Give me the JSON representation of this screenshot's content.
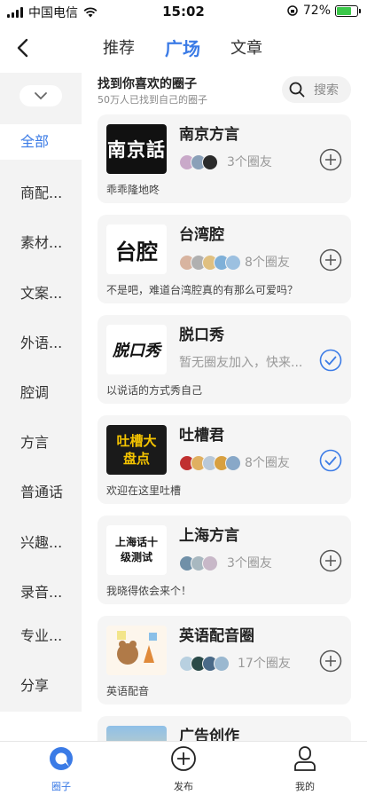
{
  "status_bar": {
    "carrier": "中国电信",
    "time": "15:02",
    "battery": "72%",
    "battery_level": 0.72
  },
  "header": {
    "tabs": [
      {
        "label": "推荐",
        "active": false
      },
      {
        "label": "广场",
        "active": true
      },
      {
        "label": "文章",
        "active": false
      }
    ]
  },
  "sidebar": {
    "items": [
      {
        "label": "全部",
        "active": true
      },
      {
        "label": "商配..."
      },
      {
        "label": "素材..."
      },
      {
        "label": "文案..."
      },
      {
        "label": "外语..."
      },
      {
        "label": "腔调"
      },
      {
        "label": "方言"
      },
      {
        "label": "普通话"
      },
      {
        "label": "兴趣..."
      },
      {
        "label": "录音..."
      },
      {
        "label": "专业..."
      },
      {
        "label": "分享"
      }
    ]
  },
  "main": {
    "title": "找到你喜欢的圈子",
    "subtitle": "50万人已找到自己的圈子",
    "search_label": "搜索",
    "groups": [
      {
        "name": "南京方言",
        "logo_text": "南京話",
        "members": "3个圈友",
        "desc": "乖乖隆地咚",
        "joined": false
      },
      {
        "name": "台湾腔",
        "logo_text": "台腔",
        "members": "8个圈友",
        "desc": "不是吧，难道台湾腔真的有那么可爱吗？",
        "joined": false
      },
      {
        "name": "脱口秀",
        "logo_text": "脱口秀",
        "members": "暂无圈友加入，快来...",
        "desc": "以说话的方式秀自己",
        "joined": true
      },
      {
        "name": "吐槽君",
        "logo_text": "吐槽大盘点",
        "members": "8个圈友",
        "desc": "欢迎在这里吐槽",
        "joined": true
      },
      {
        "name": "上海方言",
        "logo_text": "上海话十级测试",
        "members": "3个圈友",
        "desc": "我晓得侬会来个！",
        "joined": false
      },
      {
        "name": "英语配音圈",
        "logo_text": "",
        "members": "17个圈友",
        "desc": "英语配音",
        "joined": false
      },
      {
        "name": "广告创作",
        "logo_text": "",
        "members": "",
        "desc": "",
        "joined": false
      }
    ]
  },
  "bottom_nav": {
    "items": [
      {
        "label": "圈子",
        "icon": "circle-chat-icon",
        "active": true
      },
      {
        "label": "发布",
        "icon": "plus-circle-icon",
        "active": false
      },
      {
        "label": "我的",
        "icon": "user-icon",
        "active": false
      }
    ]
  },
  "colors": {
    "accent": "#3b7be6",
    "sidebar_bg": "#f3f3f3",
    "card_bg": "#f5f5f5"
  }
}
